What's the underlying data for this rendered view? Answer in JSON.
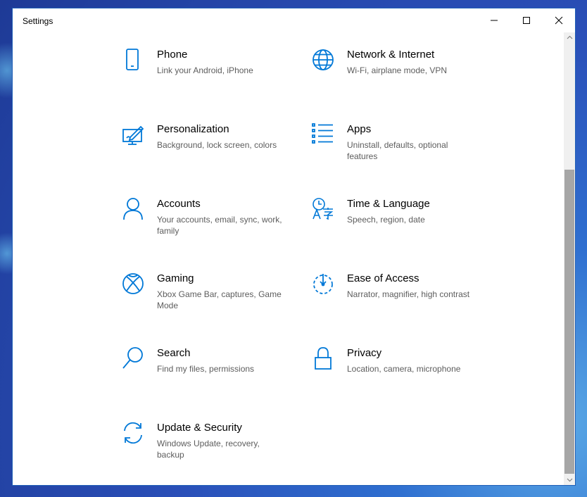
{
  "window": {
    "title": "Settings",
    "controls": {
      "minimize": "minimize-icon",
      "maximize": "maximize-icon",
      "close": "close-icon"
    }
  },
  "colors": {
    "accent": "#0078d7",
    "description": "#5d5d5d",
    "scroll_thumb": "#a6a6a6"
  },
  "tiles": [
    {
      "name": "Phone",
      "desc": "Link your Android, iPhone",
      "icon": "phone-icon"
    },
    {
      "name": "Network & Internet",
      "desc": "Wi-Fi, airplane mode, VPN",
      "icon": "globe-icon"
    },
    {
      "name": "Personalization",
      "desc": "Background, lock screen, colors",
      "icon": "personalization-icon"
    },
    {
      "name": "Apps",
      "desc": "Uninstall, defaults, optional features",
      "icon": "apps-list-icon"
    },
    {
      "name": "Accounts",
      "desc": "Your accounts, email, sync, work, family",
      "icon": "person-icon"
    },
    {
      "name": "Time & Language",
      "desc": "Speech, region, date",
      "icon": "time-language-icon"
    },
    {
      "name": "Gaming",
      "desc": "Xbox Game Bar, captures, Game Mode",
      "icon": "xbox-icon"
    },
    {
      "name": "Ease of Access",
      "desc": "Narrator, magnifier, high contrast",
      "icon": "ease-of-access-icon"
    },
    {
      "name": "Search",
      "desc": "Find my files, permissions",
      "icon": "search-icon"
    },
    {
      "name": "Privacy",
      "desc": "Location, camera, microphone",
      "icon": "lock-icon"
    },
    {
      "name": "Update & Security",
      "desc": "Windows Update, recovery, backup",
      "icon": "sync-icon"
    }
  ]
}
